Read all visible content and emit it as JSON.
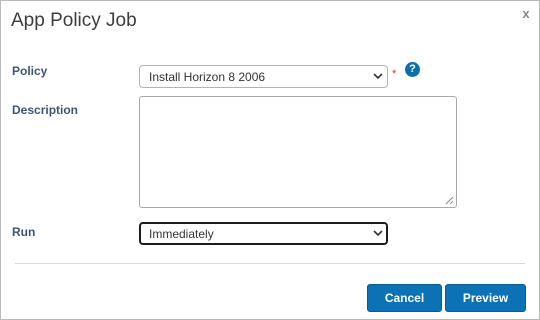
{
  "dialog": {
    "title": "App Policy Job",
    "close_label": "x"
  },
  "form": {
    "policy": {
      "label": "Policy",
      "selected_value": "Install Horizon 8 2006",
      "required_marker": "*",
      "help_label": "?"
    },
    "description": {
      "label": "Description",
      "value": ""
    },
    "run": {
      "label": "Run",
      "selected_value": "Immediately"
    }
  },
  "buttons": {
    "cancel_label": "Cancel",
    "preview_label": "Preview"
  },
  "colors": {
    "primary_button": "#0b72b5",
    "label_text": "#3d5575",
    "required": "#d2301d",
    "help_icon": "#0d6fae"
  },
  "icons": {
    "close": "close-icon",
    "help": "help-icon",
    "dropdown": "chevron-down-icon",
    "resize": "resize-grip-icon"
  }
}
